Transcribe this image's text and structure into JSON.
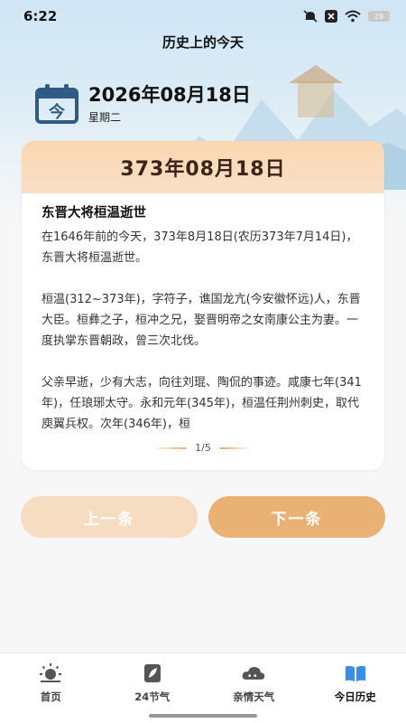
{
  "status_bar": {
    "time": "6:22",
    "battery": "28",
    "icons": [
      "mute-icon",
      "close-box-icon",
      "wifi-icon",
      "battery-icon"
    ]
  },
  "header": {
    "title": "历史上的今天",
    "date": "2026年08月18日",
    "weekday": "星期二",
    "calendar_icon_char": "今"
  },
  "card": {
    "date_title": "373年08月18日",
    "event_title": "东晋大将桓温逝世",
    "paragraphs": [
      "在1646年前的今天，373年8月18日(农历373年7月14日)，东晋大将桓温逝世。",
      "桓温(312~373年)，字符子，谯国龙亢(今安徽怀远)人，东晋大臣。桓彝之子，桓冲之兄，娶晋明帝之女南康公主为妻。一度执掌东晋朝政，曾三次北伐。",
      "父亲早逝，少有大志，向往刘琨、陶侃的事迹。咸康七年(341年)，任琅琊太守。永和元年(345年)，桓温任荆州刺史，取代庾翼兵权。次年(346年)，桓"
    ],
    "pager": "1/5"
  },
  "buttons": {
    "prev": "上一条",
    "next": "下一条"
  },
  "tabs": [
    {
      "label": "首页",
      "icon": "sun-icon"
    },
    {
      "label": "24节气",
      "icon": "leaf-icon"
    },
    {
      "label": "亲情天气",
      "icon": "cloud-icon"
    },
    {
      "label": "今日历史",
      "icon": "book-icon"
    }
  ],
  "colors": {
    "accent": "#eab174",
    "accent_light": "#f6dcc0",
    "card_header": "#fbd7b2",
    "calendar_icon": "#2f5b86",
    "active_tab": "#3a8ee6"
  }
}
